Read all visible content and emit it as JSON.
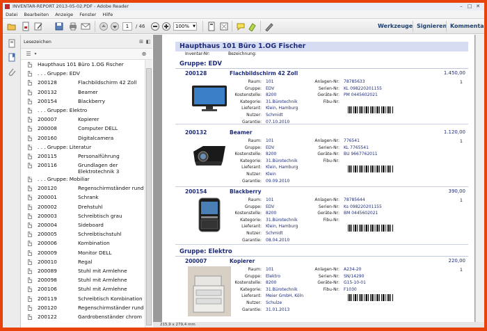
{
  "window": {
    "title": "INVENTAR-REPORT 2013-05-02.PDF - Adobe Reader"
  },
  "menu": [
    "Datei",
    "Bearbeiten",
    "Anzeige",
    "Fenster",
    "Hilfe"
  ],
  "toolbar": {
    "page_current": "1",
    "page_total": "/ 46",
    "zoom": "100%",
    "werkzeuge": "Werkzeuge",
    "signieren": "Signieren",
    "kommentar": "Kommentar"
  },
  "bookmarks": {
    "title": "Lesezeichen",
    "items": [
      {
        "a": "Haupthaus 101 Büro 1.OG  Fischer",
        "b": ""
      },
      {
        "a": ". . . Gruppe: EDV",
        "b": ""
      },
      {
        "a": "200128",
        "b": "Flachbildschirm 42 Zoll"
      },
      {
        "a": "200132",
        "b": "Beamer"
      },
      {
        "a": "200154",
        "b": "Blackberry"
      },
      {
        "a": ". . . Gruppe: Elektro",
        "b": ""
      },
      {
        "a": "200007",
        "b": "Kopierer"
      },
      {
        "a": "200008",
        "b": "Computer DELL"
      },
      {
        "a": "200160",
        "b": "Digitalcamera"
      },
      {
        "a": ". . . Gruppe: Literatur",
        "b": ""
      },
      {
        "a": "200115",
        "b": "Personalführung"
      },
      {
        "a": "200116",
        "b": "Grundlagen der Elektrotechnik 3"
      },
      {
        "a": ". . . Gruppe: Mobiliar",
        "b": ""
      },
      {
        "a": "200120",
        "b": "Regenschirmständer rund"
      },
      {
        "a": "200001",
        "b": "Schrank"
      },
      {
        "a": "200002",
        "b": "Drehstuhl"
      },
      {
        "a": "200003",
        "b": "Schreibtisch grau"
      },
      {
        "a": "200004",
        "b": "Sideboard"
      },
      {
        "a": "200005",
        "b": "Schreibtischstuhl"
      },
      {
        "a": "200006",
        "b": "Kombination"
      },
      {
        "a": "200009",
        "b": "Monitor DELL"
      },
      {
        "a": "200010",
        "b": "Regal"
      },
      {
        "a": "200089",
        "b": "Stuhl mit Armlehne"
      },
      {
        "a": "200098",
        "b": "Stuhl mit Armlehne"
      },
      {
        "a": "200106",
        "b": "Stuhl mit Armlehne"
      },
      {
        "a": "200119",
        "b": "Schreibtisch Kombination"
      },
      {
        "a": "200120",
        "b": "Regenschirmständer rund"
      },
      {
        "a": "200122",
        "b": "Gardrobenständer chrom"
      }
    ]
  },
  "doc": {
    "header": "Haupthaus 101 Büro 1.OG  Fischer",
    "sub1": "Inventar-Nr:",
    "sub2": "Bezeichnung:",
    "group1": "Gruppe: EDV",
    "group2": "Gruppe: Elektro",
    "labels": {
      "raum": "Raum:",
      "gruppe": "Gruppe:",
      "kst": "Kostenstelle:",
      "kategorie": "Kategorie:",
      "lieferant": "Lieferant:",
      "nutzer": "Nutzer:",
      "garantie": "Garantie:",
      "anlagen": "Anlagen-Nr:",
      "serien": "Serien-Nr:",
      "geraete": "Geräte-Nr:",
      "fibu": "Fibu-Nr:"
    },
    "items": [
      {
        "code": "200128",
        "name": "Flachbildschirm 42 Zoll",
        "price": "1.450,00",
        "qty": "1",
        "raum": "101",
        "gruppe": "EDV",
        "kst": "8200",
        "kategorie": "31.Bürotechnik",
        "lieferant": "Klein, Hamburg",
        "nutzer": "Schmidt",
        "garantie": "07.10.2010",
        "anlagen": "78785633",
        "serien": "KL 098220201155",
        "geraete": "PM 0445602021",
        "fibu": ""
      },
      {
        "code": "200132",
        "name": "Beamer",
        "price": "1.120,00",
        "qty": "1",
        "raum": "101",
        "gruppe": "EDV",
        "kst": "8200",
        "kategorie": "31.Bürotechnik",
        "lieferant": "Klein, Hamburg",
        "nutzer": "Klein",
        "garantie": "09.09.2010",
        "anlagen": "776541",
        "serien": "KL 7765541",
        "geraete": "BU 9667762011",
        "fibu": ""
      },
      {
        "code": "200154",
        "name": "Blackberry",
        "price": "390,00",
        "qty": "1",
        "raum": "101",
        "gruppe": "EDV",
        "kst": "8200",
        "kategorie": "31.Bürotechnik",
        "lieferant": "Klein, Hamburg",
        "nutzer": "Schmidt",
        "garantie": "08.04.2010",
        "anlagen": "78785644",
        "serien": "Ks 098220201155",
        "geraete": "BM 0445602021",
        "fibu": ""
      },
      {
        "code": "200007",
        "name": "Kopierer",
        "price": "220,00",
        "qty": "1",
        "raum": "101",
        "gruppe": "Elektro",
        "kst": "8200",
        "kategorie": "31.Bürotechnik",
        "lieferant": "Meier GmbH, Köln",
        "nutzer": "Schulze",
        "garantie": "31.01.2013",
        "anlagen": "A234-20",
        "serien": "SN/14290",
        "geraete": "G15-10-01",
        "fibu": "F1030"
      }
    ]
  },
  "status": {
    "size": "215,9 x 279,4 mm"
  },
  "colors": {
    "border": "#e8430b",
    "header_bg": "#d6dcf2",
    "doc_text": "#1e2c7a"
  }
}
